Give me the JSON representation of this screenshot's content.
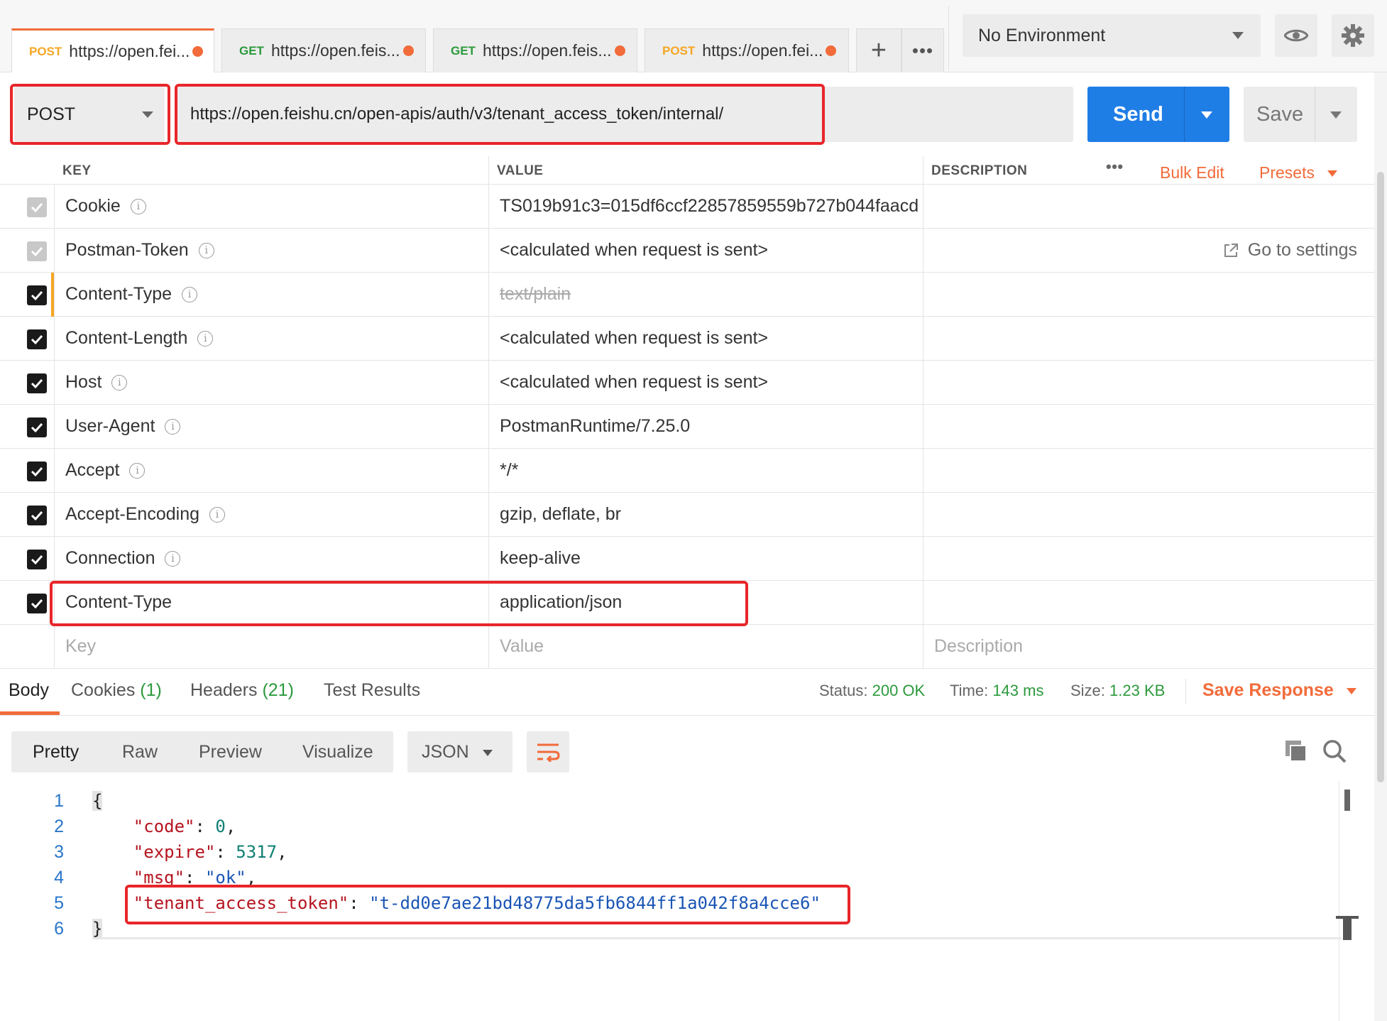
{
  "tabs": [
    {
      "method": "POST",
      "url": "https://open.fei...",
      "active": true
    },
    {
      "method": "GET",
      "url": "https://open.feis...",
      "active": false
    },
    {
      "method": "GET",
      "url": "https://open.feis...",
      "active": false
    },
    {
      "method": "POST",
      "url": "https://open.fei...",
      "active": false
    }
  ],
  "environment": {
    "selected": "No Environment"
  },
  "request": {
    "method": "POST",
    "url": "https://open.feishu.cn/open-apis/auth/v3/tenant_access_token/internal/",
    "send_label": "Send",
    "save_label": "Save"
  },
  "headers_table": {
    "col_key": "KEY",
    "col_value": "VALUE",
    "col_description": "DESCRIPTION",
    "more": "•••",
    "bulk_edit": "Bulk Edit",
    "presets": "Presets",
    "go_to_settings": "Go to settings",
    "rows": [
      {
        "key": "Cookie",
        "value": "TS019b91c3=015df6ccf22857859559b727b044faacd",
        "checked": true,
        "auto": true
      },
      {
        "key": "Postman-Token",
        "value": "<calculated when request is sent>",
        "checked": true,
        "auto": true
      },
      {
        "key": "Content-Type",
        "value": "text/plain",
        "checked": true,
        "overridden": true
      },
      {
        "key": "Content-Length",
        "value": "<calculated when request is sent>",
        "checked": true
      },
      {
        "key": "Host",
        "value": "<calculated when request is sent>",
        "checked": true
      },
      {
        "key": "User-Agent",
        "value": "PostmanRuntime/7.25.0",
        "checked": true
      },
      {
        "key": "Accept",
        "value": "*/*",
        "checked": true
      },
      {
        "key": "Accept-Encoding",
        "value": "gzip, deflate, br",
        "checked": true
      },
      {
        "key": "Connection",
        "value": "keep-alive",
        "checked": true
      },
      {
        "key": "Content-Type",
        "value": "application/json",
        "checked": true
      }
    ],
    "placeholder_key": "Key",
    "placeholder_value": "Value",
    "placeholder_description": "Description"
  },
  "response": {
    "tabs": {
      "body": "Body",
      "cookies": "Cookies",
      "cookies_count": "(1)",
      "headers": "Headers",
      "headers_count": "(21)",
      "test_results": "Test Results"
    },
    "status_label": "Status:",
    "status": "200 OK",
    "time_label": "Time:",
    "time": "143 ms",
    "size_label": "Size:",
    "size": "1.23 KB",
    "save_response": "Save Response",
    "modes": [
      "Pretty",
      "Raw",
      "Preview",
      "Visualize"
    ],
    "active_mode": "Pretty",
    "format": "JSON",
    "line_numbers": [
      "1",
      "2",
      "3",
      "4",
      "5",
      "6"
    ],
    "body": {
      "open_brace": "{",
      "close_brace": "}",
      "code_key": "\"code\"",
      "code_val": "0",
      "expire_key": "\"expire\"",
      "expire_val": "5317",
      "msg_key": "\"msg\"",
      "msg_val": "\"ok\"",
      "token_key": "\"tenant_access_token\"",
      "token_val": "\"t-dd0e7ae21bd48775da5fb6844ff1a042f8a4cce6\""
    }
  },
  "colors": {
    "accent": "#f26b3a",
    "send": "#1f7de6",
    "success": "#2b9a3c",
    "highlight": "#e8262a"
  }
}
